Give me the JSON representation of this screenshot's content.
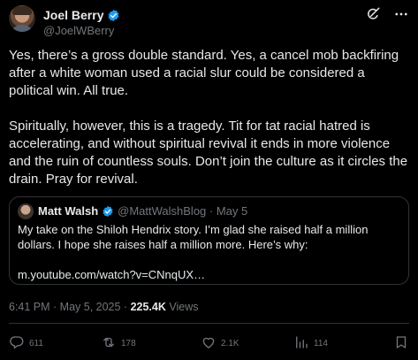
{
  "author": {
    "display_name": "Joel Berry",
    "handle": "@JoelWBerry"
  },
  "tweet_text": "Yes, there’s a gross double standard. Yes, a cancel mob backfiring after a white woman used a racial slur could be considered a political win. All true.\n\nSpiritually, however, this is a tragedy. Tit for tat racial hatred is accelerating, and without spiritual revival it ends in more violence and the ruin of countless souls. Don’t join the culture as it circles the drain. Pray for revival.",
  "quoted": {
    "display_name": "Matt Walsh",
    "handle_date": "@MattWalshBlog · May 5",
    "text": "My take on the Shiloh Hendrix story. I’m glad she raised half a million dollars. I hope she raises half a million more. Here’s why:\n\nm.youtube.com/watch?v=CNnqUX…"
  },
  "meta": {
    "timestamp": "6:41 PM · May 5, 2025 · ",
    "views_count": "225.4K",
    "views_label": " Views"
  },
  "actions": {
    "replies": "611",
    "reposts": "178",
    "likes": "2.1K",
    "views": "114"
  },
  "colors": {
    "background": "#000000",
    "text": "#e7e9ea",
    "muted": "#71767b",
    "border": "#2f3336",
    "verified": "#1d9bf0"
  },
  "icons": [
    "verified-badge-icon",
    "grok-icon",
    "more-icon",
    "reply-icon",
    "repost-icon",
    "like-icon",
    "views-icon",
    "bookmark-icon"
  ]
}
